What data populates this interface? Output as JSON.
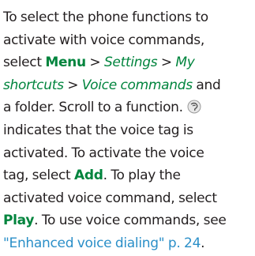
{
  "paragraph": {
    "l1": "To select the phone functions to",
    "l2": "activate with voice commands,",
    "l3_select": "select ",
    "menu": "Menu",
    "sep": " > ",
    "settings": "Settings",
    "my": "My",
    "shortcuts": "shortcuts",
    "voice_commands": "Voice commands",
    "and": " and",
    "l5": "a folder. Scroll to a function.",
    "l6": "indicates that the voice tag is",
    "l7": "activated. To activate the voice",
    "l8_a": "tag, select ",
    "add": "Add",
    "period": ".",
    "l8_b": " To play the",
    "l9": "activated voice command, select",
    "play": "Play",
    "l10_b": ". To use voice commands, see",
    "link_text": "\"Enhanced voice dialing\" p. 24",
    "link_end": "."
  },
  "icons": {
    "voice_tag": "voice-tag-icon"
  }
}
